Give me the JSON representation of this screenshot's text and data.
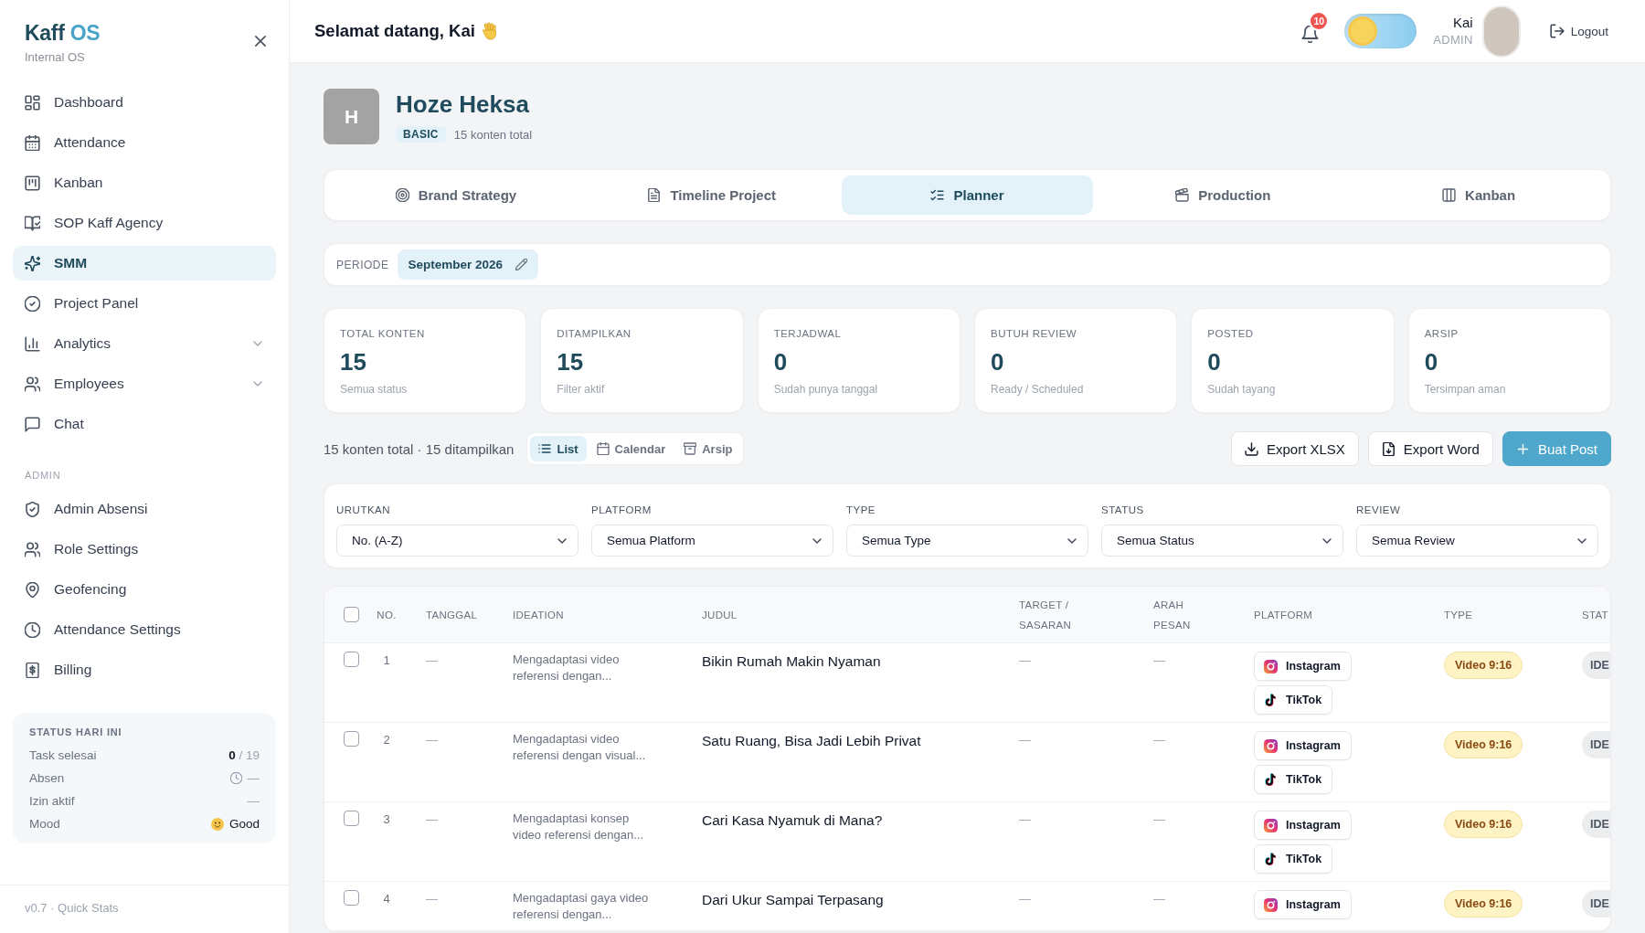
{
  "sidebar": {
    "brand": {
      "name": "Kaff",
      "accent": "OS",
      "subtitle": "Internal OS"
    },
    "nav_items": [
      {
        "label": "Dashboard",
        "kind": "link",
        "selected": false
      },
      {
        "label": "Attendance",
        "kind": "link",
        "selected": false
      },
      {
        "label": "Kanban",
        "kind": "link",
        "selected": false
      },
      {
        "label": "SOP Kaff Agency",
        "kind": "link",
        "selected": false
      },
      {
        "label": "SMM",
        "kind": "link",
        "selected": true
      },
      {
        "label": "Project Panel",
        "kind": "link",
        "selected": false
      },
      {
        "label": "Analytics",
        "kind": "group",
        "selected": false
      },
      {
        "label": "Employees",
        "kind": "group",
        "selected": false
      },
      {
        "label": "Chat",
        "kind": "link",
        "selected": false
      }
    ],
    "admin_section": {
      "heading": "ADMIN",
      "items": [
        {
          "label": "Admin Absensi",
          "selected": false
        },
        {
          "label": "Role Settings",
          "selected": false
        },
        {
          "label": "Geofencing",
          "selected": false
        },
        {
          "label": "Attendance Settings",
          "selected": false
        },
        {
          "label": "Billing",
          "selected": false
        }
      ]
    },
    "status_card": {
      "title": "STATUS HARI INI",
      "rows": [
        {
          "label": "Task selesai",
          "kind": "count",
          "value": "**0** / 19"
        },
        {
          "label": "Absen",
          "kind": "clock",
          "value": "—"
        },
        {
          "label": "Izin aktif",
          "kind": "plain",
          "value": "—"
        },
        {
          "label": "Mood",
          "kind": "mood",
          "value": "Good"
        }
      ]
    },
    "footer": "v0.7 · Quick Stats"
  },
  "header": {
    "greeting": "Selamat datang, Kai",
    "notifications": {
      "count": "10"
    },
    "theme_toggle": {
      "dark": false
    },
    "user": {
      "name": "Kai",
      "role": "ADMIN"
    },
    "logout": "Logout"
  },
  "profile": {
    "initial": "H",
    "name": "Hoze Heksa",
    "plan": "BASIC",
    "summary": "15 konten total"
  },
  "tabs": [
    {
      "label": "Brand Strategy",
      "selected": false
    },
    {
      "label": "Timeline Project",
      "selected": false
    },
    {
      "label": "Planner",
      "selected": true
    },
    {
      "label": "Production",
      "selected": false
    },
    {
      "label": "Kanban",
      "selected": false
    }
  ],
  "period": {
    "label": "PERIODE",
    "value": "September 2026"
  },
  "stats": [
    {
      "label": "TOTAL KONTEN",
      "value": "15",
      "caption": "Semua status"
    },
    {
      "label": "DITAMPILKAN",
      "value": "15",
      "caption": "Filter aktif"
    },
    {
      "label": "TERJADWAL",
      "value": "0",
      "caption": "Sudah punya tanggal"
    },
    {
      "label": "BUTUH REVIEW",
      "value": "0",
      "caption": "Ready / Scheduled"
    },
    {
      "label": "POSTED",
      "value": "0",
      "caption": "Sudah tayang"
    },
    {
      "label": "ARSIP",
      "value": "0",
      "caption": "Tersimpan aman"
    }
  ],
  "toolbar": {
    "summary": "15 konten total · 15 ditampilkan",
    "views": [
      {
        "label": "List",
        "selected": true
      },
      {
        "label": "Calendar",
        "selected": false
      },
      {
        "label": "Arsip",
        "selected": false
      }
    ],
    "actions": [
      {
        "label": "Export XLSX",
        "kind": "outline"
      },
      {
        "label": "Export Word",
        "kind": "outline"
      },
      {
        "label": "Buat Post",
        "kind": "primary"
      }
    ]
  },
  "filters": [
    {
      "label": "URUTKAN",
      "value": "No. (A-Z)"
    },
    {
      "label": "PLATFORM",
      "value": "Semua Platform"
    },
    {
      "label": "TYPE",
      "value": "Semua Type"
    },
    {
      "label": "STATUS",
      "value": "Semua Status"
    },
    {
      "label": "REVIEW",
      "value": "Semua Review"
    }
  ],
  "table": {
    "select_all": {
      "checked": false
    },
    "columns": [
      "NO.",
      "TANGGAL",
      "IDEATION",
      "JUDUL",
      "TARGET / SASARAN",
      "ARAH PESAN",
      "PLATFORM",
      "TYPE",
      "STAT"
    ],
    "rows": [
      {
        "checked": false,
        "no": "1",
        "tanggal": "—",
        "ideation": "Mengadaptasi video referensi dengan...",
        "judul": "Bikin Rumah Makin Nyaman",
        "target_sasaran": "—",
        "arah_pesan": "—",
        "platforms": [
          {
            "kind": "instagram",
            "label": "Instagram"
          },
          {
            "kind": "tiktok",
            "label": "TikTok"
          }
        ],
        "type": "Video 9:16",
        "column_9": "IDE"
      },
      {
        "checked": false,
        "no": "2",
        "tanggal": "—",
        "ideation": "Mengadaptasi video referensi dengan visual...",
        "judul": "Satu Ruang, Bisa Jadi Lebih Privat",
        "target_sasaran": "—",
        "arah_pesan": "—",
        "platforms": [
          {
            "kind": "instagram",
            "label": "Instagram"
          },
          {
            "kind": "tiktok",
            "label": "TikTok"
          }
        ],
        "type": "Video 9:16",
        "column_9": "IDE"
      },
      {
        "checked": false,
        "no": "3",
        "tanggal": "—",
        "ideation": "Mengadaptasi konsep video referensi dengan...",
        "judul": "Cari Kasa Nyamuk di Mana?",
        "target_sasaran": "—",
        "arah_pesan": "—",
        "platforms": [
          {
            "kind": "instagram",
            "label": "Instagram"
          },
          {
            "kind": "tiktok",
            "label": "TikTok"
          }
        ],
        "type": "Video 9:16",
        "column_9": "IDE"
      },
      {
        "checked": false,
        "no": "4",
        "tanggal": "—",
        "ideation": "Mengadaptasi gaya video referensi dengan...",
        "judul": "Dari Ukur Sampai Terpasang",
        "target_sasaran": "—",
        "arah_pesan": "—",
        "platforms": [
          {
            "kind": "instagram",
            "label": "Instagram"
          }
        ],
        "type": "Video 9:16",
        "column_9": "IDE"
      }
    ]
  }
}
